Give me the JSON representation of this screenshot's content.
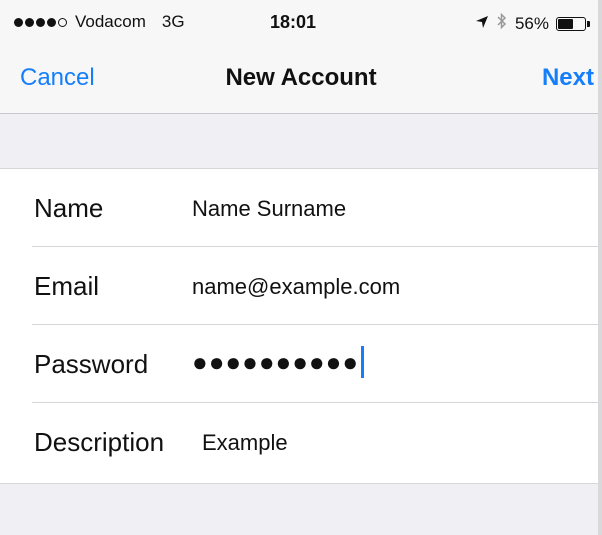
{
  "status_bar": {
    "carrier": "Vodacom",
    "network": "3G",
    "time": "18:01",
    "battery": "56%",
    "battery_level": 0.56,
    "signal_bars_filled": 4,
    "signal_bars_total": 5,
    "icons": [
      "location-arrow-icon",
      "bluetooth-icon",
      "battery-icon"
    ]
  },
  "nav": {
    "cancel_label": "Cancel",
    "title": "New Account",
    "next_label": "Next",
    "accent_color": "#157efb"
  },
  "form": {
    "name_label": "Name",
    "name_value": "Name Surname",
    "email_label": "Email",
    "email_value": "name@example.com",
    "password_label": "Password",
    "password_value": "●●●●●●●●●●",
    "description_label": "Description",
    "description_value": "Example"
  }
}
